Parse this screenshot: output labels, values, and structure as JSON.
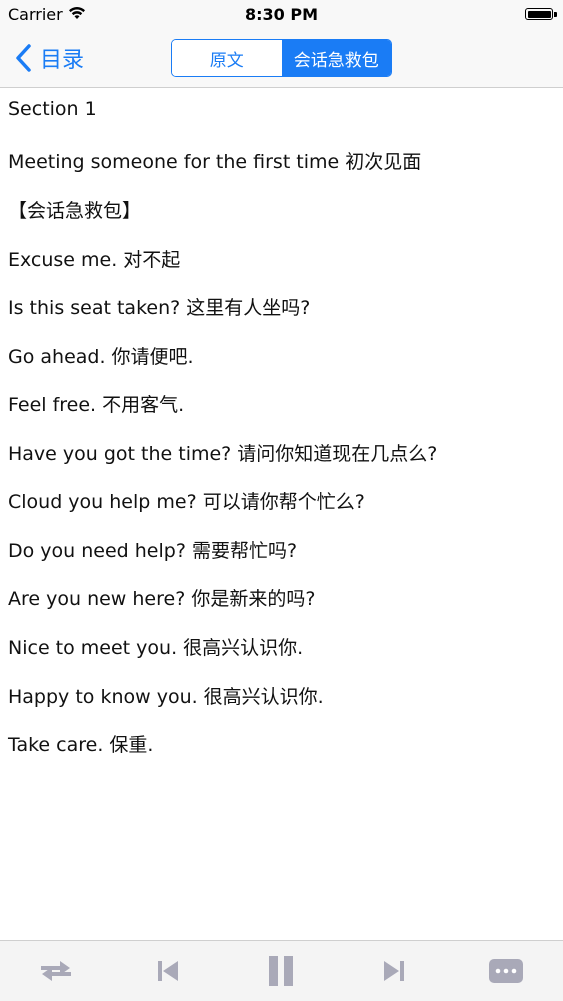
{
  "status_bar": {
    "carrier": "Carrier",
    "time": "8:30 PM",
    "wifi_icon": "wifi-icon",
    "battery_icon": "battery-icon"
  },
  "nav": {
    "back_label": "目录",
    "back_icon": "chevron-left-icon",
    "segments": [
      {
        "label": "原文",
        "selected": false
      },
      {
        "label": "会话急救包",
        "selected": true
      }
    ],
    "accent_color": "#1a7cf5"
  },
  "content": {
    "lines": [
      "Section 1",
      "Meeting someone for the first time 初次见面",
      "【会话急救包】",
      "Excuse me. 对不起",
      "Is this seat taken? 这里有人坐吗?",
      "Go ahead. 你请便吧.",
      "Feel free. 不用客气.",
      "Have you got the time? 请问你知道现在几点么?",
      "Cloud you help me? 可以请你帮个忙么?",
      "Do you need help? 需要帮忙吗?",
      "Are you new here? 你是新来的吗?",
      "Nice to meet you. 很高兴认识你.",
      "Happy to know you. 很高兴认识你.",
      "Take care. 保重."
    ]
  },
  "toolbar": {
    "icons": [
      "shuffle-icon",
      "previous-icon",
      "pause-icon",
      "next-icon",
      "more-icon"
    ],
    "icon_color": "#a9a9b8"
  }
}
